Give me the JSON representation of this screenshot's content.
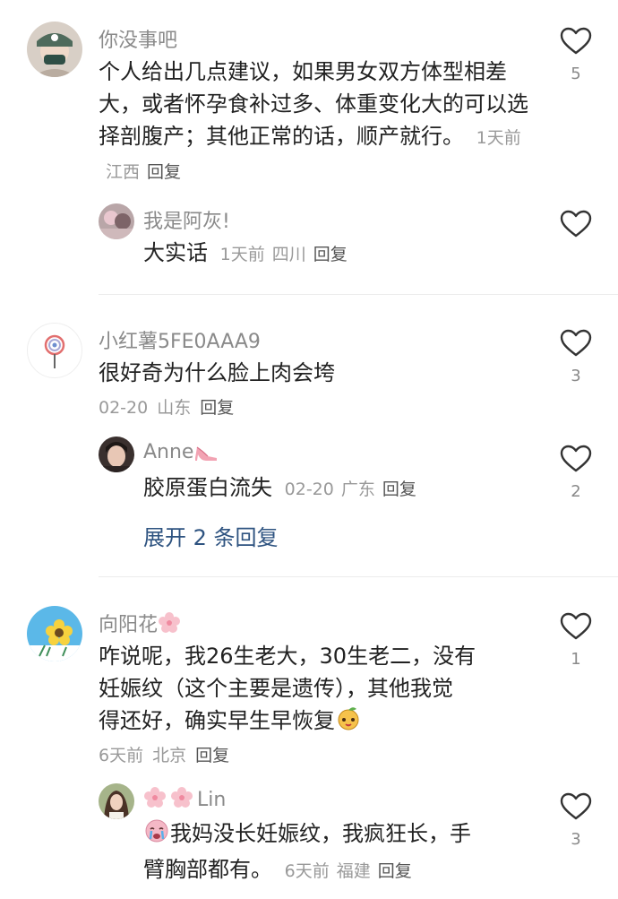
{
  "comments": [
    {
      "user": "你没事吧",
      "text": "个人给出几点建议，如果男女双方体型相差大，或者怀孕食补过多、体重变化大的可以选择剖腹产；其他正常的话，顺产就行。",
      "time": "1天前",
      "location": "江西",
      "reply_label": "回复",
      "likes": "5",
      "replies": [
        {
          "user": "我是阿灰!",
          "text": "大实话",
          "time": "1天前",
          "location": "四川",
          "reply_label": "回复",
          "likes": ""
        }
      ]
    },
    {
      "user": "小红薯5FE0AAA9",
      "text": "很好奇为什么脸上肉会垮",
      "time": "02-20",
      "location": "山东",
      "reply_label": "回复",
      "likes": "3",
      "replies": [
        {
          "user": "Anne",
          "user_emoji": "high-heel-emoji",
          "text": "胶原蛋白流失",
          "time": "02-20",
          "location": "广东",
          "reply_label": "回复",
          "likes": "2"
        }
      ],
      "expand_label": "展开 2 条回复"
    },
    {
      "user": "向阳花",
      "user_emoji": "cherry-blossom-emoji",
      "text_line1": "咋说呢，我26生老大，30生老二，没有",
      "text_line2": "妊娠纹（这个主要是遗传），其他我觉",
      "text_line3": "得还好，确实早生早恢复",
      "text_emoji": "cute-peach-emoji",
      "time": "6天前",
      "location": "北京",
      "reply_label": "回复",
      "likes": "1",
      "replies": [
        {
          "user": "Lin",
          "user_emoji": "cherry-blossom-emoji",
          "text_line1": "我妈没长妊娠纹，我疯狂长，手",
          "text_line2": "臂胸部都有。",
          "text_emoji": "crying-face-emoji",
          "time": "6天前",
          "location": "福建",
          "reply_label": "回复",
          "likes": "3"
        }
      ]
    }
  ],
  "icons": {
    "like": "heart-outline-icon"
  },
  "colors": {
    "text": "#222222",
    "meta": "#999999",
    "username": "#8a8a8a",
    "link": "#2e5380",
    "divider": "#ececec"
  }
}
